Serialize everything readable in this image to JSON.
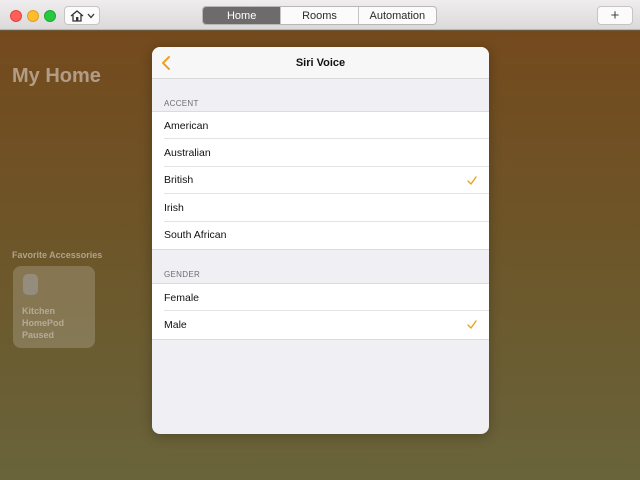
{
  "toolbar": {
    "tabs": [
      {
        "label": "Home",
        "active": true
      },
      {
        "label": "Rooms",
        "active": false
      },
      {
        "label": "Automation",
        "active": false
      }
    ],
    "add_label": "+",
    "home_picker_icon": "house-icon"
  },
  "background": {
    "title": "My Home",
    "favorites_title": "Favorite Accessories",
    "accessory": {
      "icon": "homepod-icon",
      "line1": "Kitchen",
      "line2": "HomePod",
      "status": "Paused"
    }
  },
  "modal": {
    "title": "Siri Voice",
    "back_icon": "chevron-left-icon",
    "accent_header": "ACCENT",
    "accent_options": [
      {
        "label": "American",
        "selected": false
      },
      {
        "label": "Australian",
        "selected": false
      },
      {
        "label": "British",
        "selected": true
      },
      {
        "label": "Irish",
        "selected": false
      },
      {
        "label": "South African",
        "selected": false
      }
    ],
    "gender_header": "GENDER",
    "gender_options": [
      {
        "label": "Female",
        "selected": false
      },
      {
        "label": "Male",
        "selected": true
      }
    ]
  },
  "colors": {
    "accent": "#f0a020",
    "active_tab": "#6d6b6c"
  }
}
